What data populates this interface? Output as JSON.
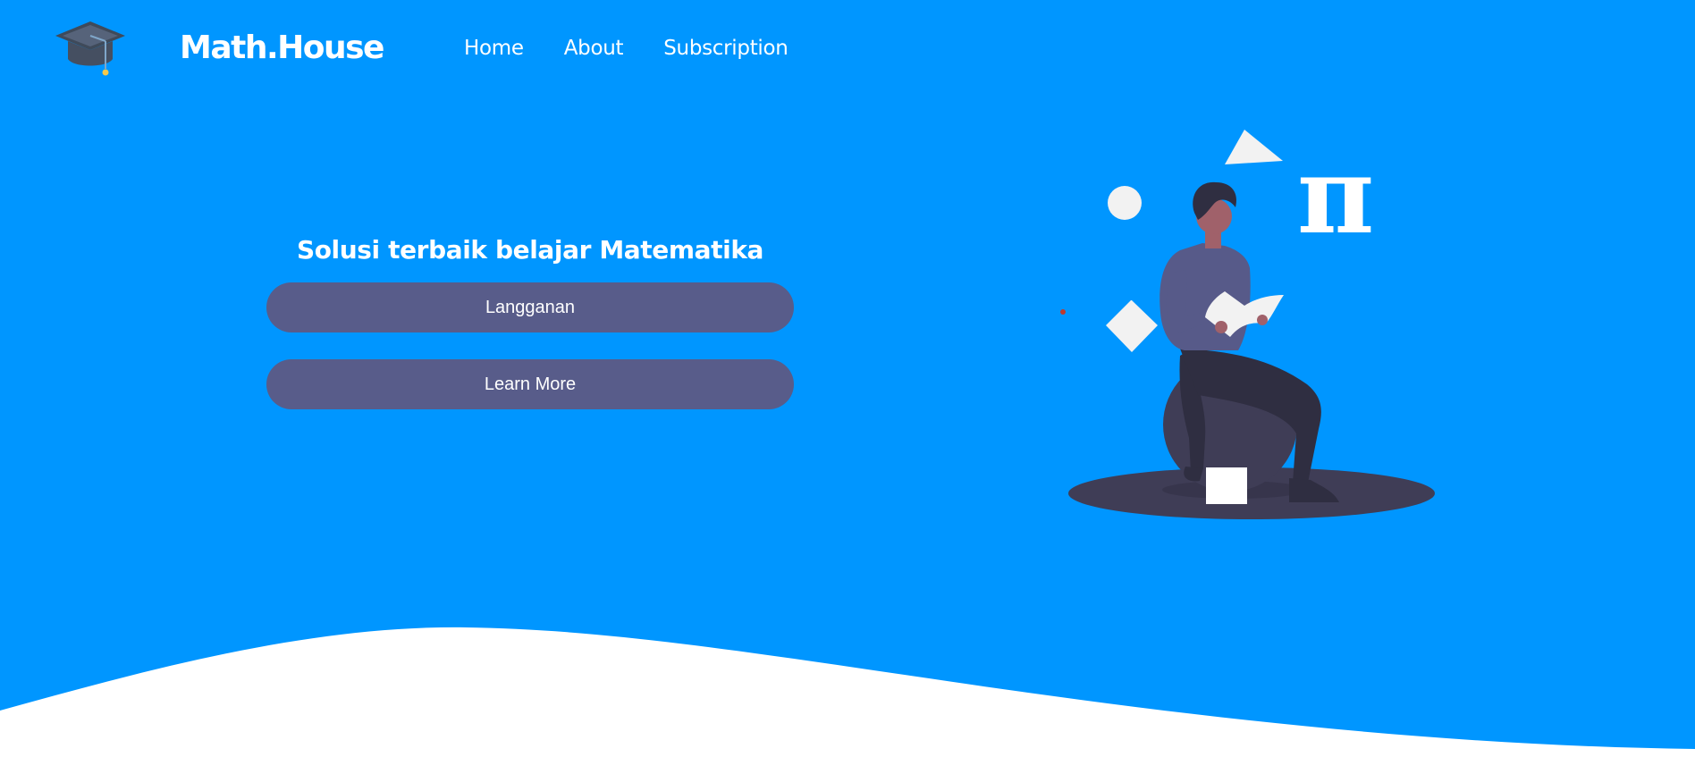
{
  "header": {
    "brand": "Math.House",
    "nav": [
      {
        "label": "Home"
      },
      {
        "label": "About"
      },
      {
        "label": "Subscription"
      }
    ]
  },
  "hero": {
    "tagline": "Solusi terbaik belajar Matematika",
    "primary_button": "Langganan",
    "secondary_button": "Learn More",
    "pi_symbol": "π"
  },
  "colors": {
    "hero_background": "#0096ff",
    "button_background": "#585c8a",
    "wave": "#ffffff",
    "illustration_dark": "#3f3d56"
  },
  "icons": {
    "logo": "graduation-cap-icon"
  }
}
